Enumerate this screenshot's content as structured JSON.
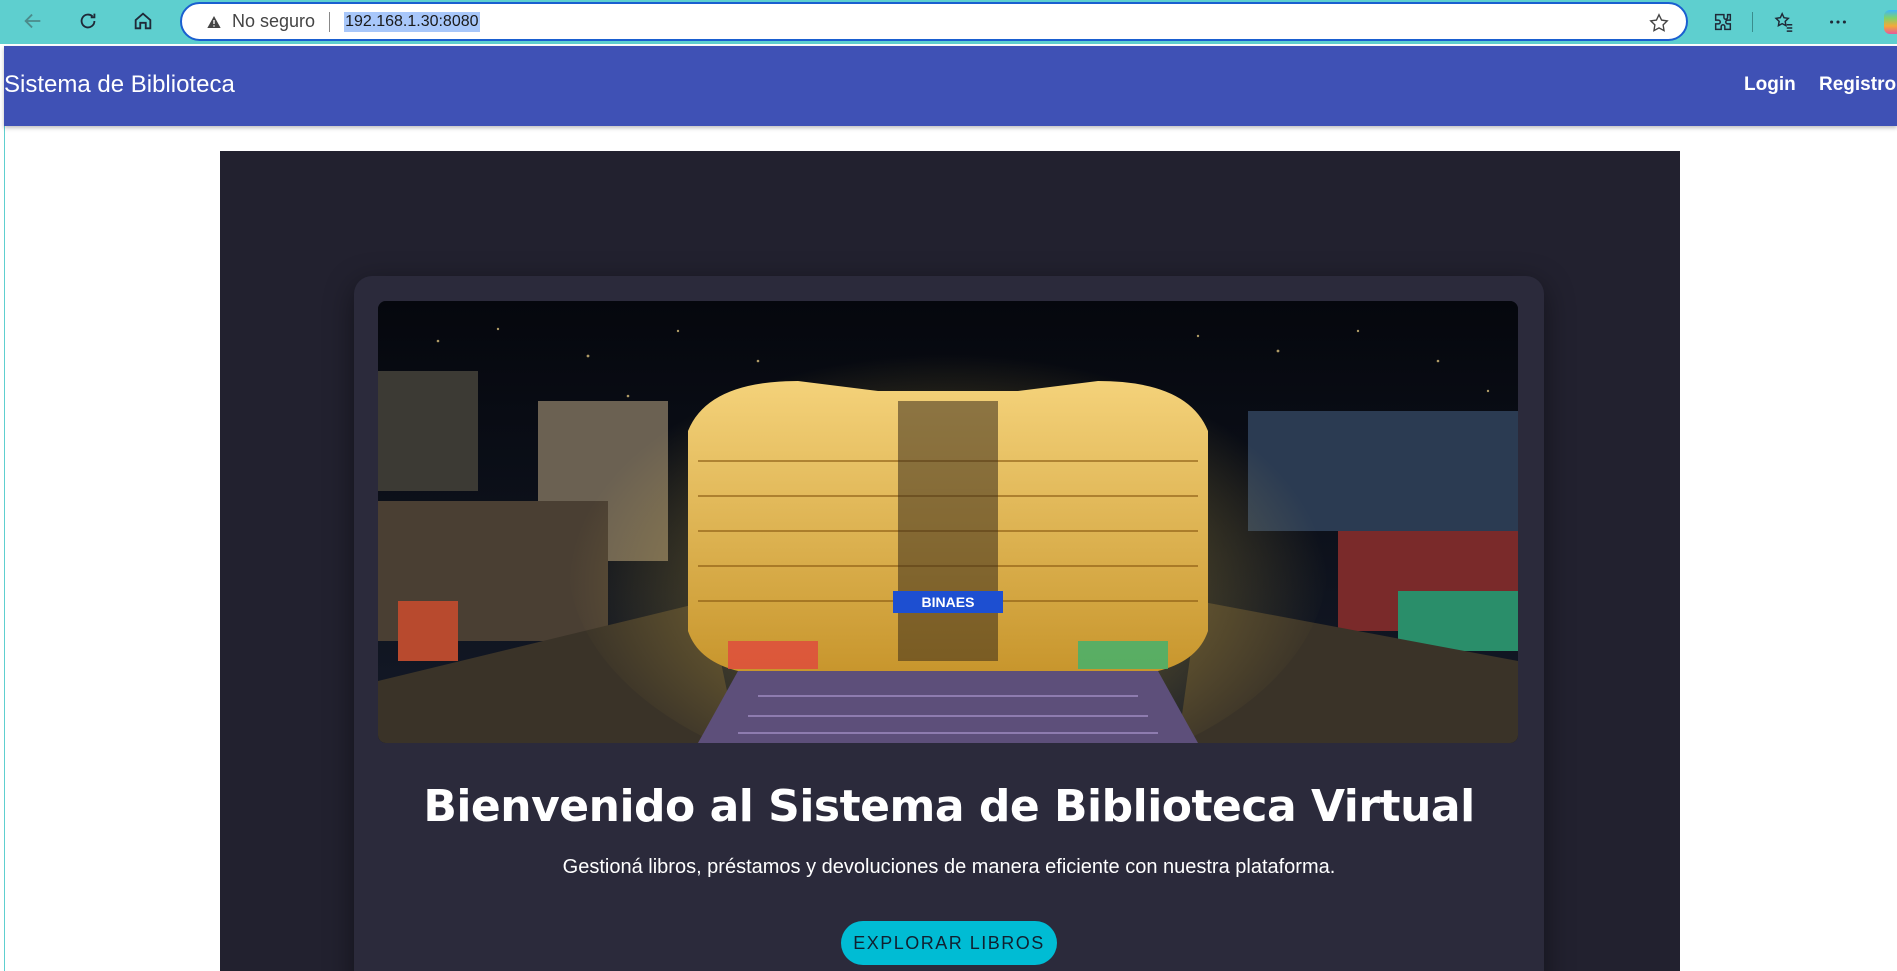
{
  "browser": {
    "security_label": "No seguro",
    "url": "192.168.1.30:8080",
    "icons": [
      "back-arrow-icon",
      "refresh-icon",
      "home-icon",
      "warning-icon",
      "star-icon",
      "extensions-icon",
      "favorites-icon",
      "more-icon"
    ]
  },
  "navbar": {
    "brand": "Sistema de Biblioteca",
    "links": [
      "Login",
      "Registro"
    ],
    "color": "#3f51b5"
  },
  "hero": {
    "image_sign": "BINAES",
    "title": "Bienvenido al Sistema de Biblioteca Virtual",
    "subtitle": "Gestioná libros, préstamos y devoluciones de manera eficiente con nuestra plataforma.",
    "cta_label": "EXPLORAR LIBROS",
    "cta_color": "#00bcd4"
  }
}
